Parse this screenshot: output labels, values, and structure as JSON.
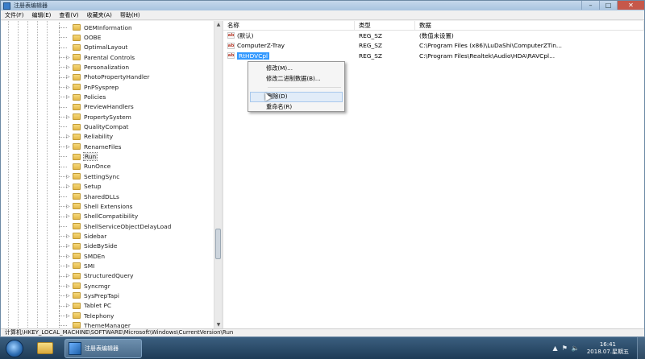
{
  "window": {
    "title": "注册表编辑器",
    "min": "–",
    "max": "□",
    "close": "✕"
  },
  "menu": [
    "文件(F)",
    "编辑(E)",
    "查看(V)",
    "收藏夹(A)",
    "帮助(H)"
  ],
  "tree": {
    "items": [
      {
        "label": "OEMInformation",
        "expander": ""
      },
      {
        "label": "OOBE",
        "expander": ""
      },
      {
        "label": "OptimalLayout",
        "expander": ""
      },
      {
        "label": "Parental Controls",
        "expander": "▷"
      },
      {
        "label": "Personalization",
        "expander": "▷"
      },
      {
        "label": "PhotoPropertyHandler",
        "expander": "▷"
      },
      {
        "label": "PnPSysprep",
        "expander": "▷"
      },
      {
        "label": "Policies",
        "expander": "▷"
      },
      {
        "label": "PreviewHandlers",
        "expander": ""
      },
      {
        "label": "PropertySystem",
        "expander": "▷"
      },
      {
        "label": "QualityCompat",
        "expander": ""
      },
      {
        "label": "Reliability",
        "expander": "▷"
      },
      {
        "label": "RenameFiles",
        "expander": "▷"
      },
      {
        "label": "Run",
        "expander": "",
        "selected": true
      },
      {
        "label": "RunOnce",
        "expander": ""
      },
      {
        "label": "SettingSync",
        "expander": "▷"
      },
      {
        "label": "Setup",
        "expander": "▷"
      },
      {
        "label": "SharedDLLs",
        "expander": ""
      },
      {
        "label": "Shell Extensions",
        "expander": "▷"
      },
      {
        "label": "ShellCompatibility",
        "expander": "▷"
      },
      {
        "label": "ShellServiceObjectDelayLoad",
        "expander": ""
      },
      {
        "label": "Sidebar",
        "expander": "▷"
      },
      {
        "label": "SideBySide",
        "expander": "▷"
      },
      {
        "label": "SMDEn",
        "expander": "▷"
      },
      {
        "label": "SMI",
        "expander": "▷"
      },
      {
        "label": "StructuredQuery",
        "expander": "▷"
      },
      {
        "label": "Syncmgr",
        "expander": "▷"
      },
      {
        "label": "SysPrepTapi",
        "expander": "▷"
      },
      {
        "label": "Tablet PC",
        "expander": "▷"
      },
      {
        "label": "Telephony",
        "expander": "▷"
      },
      {
        "label": "ThemeManager",
        "expander": ""
      }
    ]
  },
  "list": {
    "headers": {
      "name": "名称",
      "type": "类型",
      "data": "数据"
    },
    "rows": [
      {
        "name": "(默认)",
        "type": "REG_SZ",
        "data": "(数值未设置)"
      },
      {
        "name": "ComputerZ-Tray",
        "type": "REG_SZ",
        "data": "C:\\Program Files (x86)\\LuDaShi\\ComputerZTin..."
      },
      {
        "name": "RtHDVCpl",
        "type": "REG_SZ",
        "data": "C:\\Program Files\\Realtek\\Audio\\HDA\\RAVCpl..."
      }
    ],
    "value_icon": "ab"
  },
  "context_menu": {
    "modify": "修改(M)...",
    "modify_binary": "修改二进制数据(B)...",
    "delete": "删除(D)",
    "rename": "重命名(R)"
  },
  "status": {
    "path": "计算机\\HKEY_LOCAL_MACHINE\\SOFTWARE\\Microsoft\\Windows\\CurrentVersion\\Run"
  },
  "taskbar": {
    "regedit_label": "注册表编辑器",
    "time": "16:41",
    "date": "2018.07.星期五",
    "tray_up": "▲",
    "tray_flag": "⚑",
    "tray_volume": "🔈"
  }
}
